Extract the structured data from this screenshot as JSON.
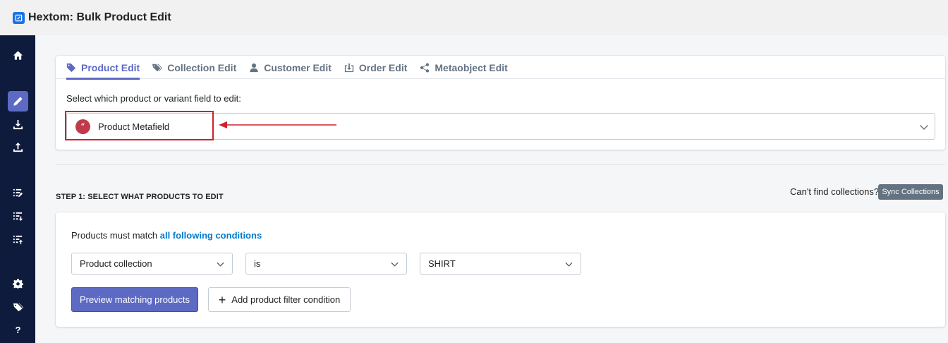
{
  "app": {
    "title": "Hextom: Bulk Product Edit"
  },
  "sidebar": {
    "items": [
      {
        "icon": "home-icon"
      },
      {
        "icon": "pencil-icon",
        "active": true
      },
      {
        "icon": "download-icon"
      },
      {
        "icon": "upload-icon"
      },
      {
        "icon": "list-edit-icon"
      },
      {
        "icon": "list-download-icon"
      },
      {
        "icon": "list-upload-icon"
      },
      {
        "icon": "gear-icon"
      },
      {
        "icon": "tags-icon"
      },
      {
        "icon": "help-icon"
      }
    ]
  },
  "tabs": [
    {
      "label": "Product Edit",
      "icon": "tag-icon",
      "active": true
    },
    {
      "label": "Collection Edit",
      "icon": "tags-icon"
    },
    {
      "label": "Customer Edit",
      "icon": "user-icon"
    },
    {
      "label": "Order Edit",
      "icon": "download-box-icon"
    },
    {
      "label": "Metaobject Edit",
      "icon": "share-icon"
    }
  ],
  "field_select": {
    "label": "Select which product or variant field to edit:",
    "value": "Product Metafield",
    "icon_glyph": "“"
  },
  "step1": {
    "title": "STEP 1: SELECT WHAT PRODUCTS TO EDIT",
    "cant_find": "Can't find collections?",
    "sync_button": "Sync Collections",
    "match_prefix": "Products must match",
    "match_link": "all following conditions",
    "condition": {
      "field": "Product collection",
      "operator": "is",
      "value": "SHIRT"
    },
    "preview_button": "Preview matching products",
    "add_button": "Add product filter condition",
    "add_symbol": "+"
  },
  "colors": {
    "accent": "#5c6ac4",
    "sidebar_bg": "#0e1b3d",
    "link": "#007ace",
    "highlight": "#d0202a",
    "metafield_icon": "#c03a4b"
  }
}
